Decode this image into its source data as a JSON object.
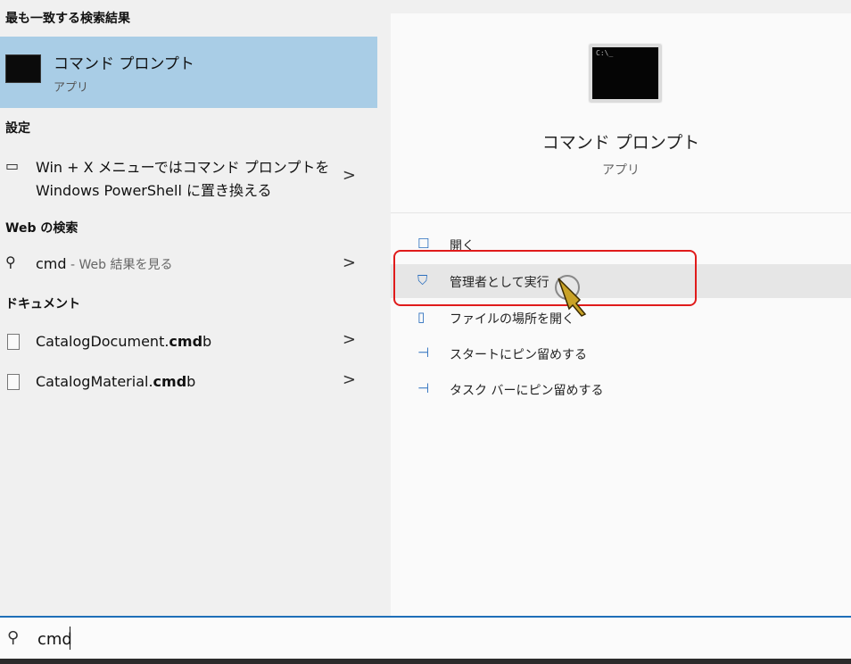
{
  "left": {
    "best_match_heading": "最も一致する検索結果",
    "best_match": {
      "title": "コマンド プロンプト",
      "subtitle": "アプリ"
    },
    "settings_heading": "設定",
    "settings_item": {
      "line1": "Win + X メニューではコマンド プロンプトを",
      "line2": "Windows PowerShell に置き換える"
    },
    "web_heading": "Web の検索",
    "web_item": {
      "query": "cmd",
      "suffix": " - Web 結果を見る"
    },
    "docs_heading": "ドキュメント",
    "docs": [
      {
        "prefix": "CatalogDocument.",
        "bold": "cmd",
        "suffix": "b"
      },
      {
        "prefix": "CatalogMaterial.",
        "bold": "cmd",
        "suffix": "b"
      }
    ],
    "chevron": ">"
  },
  "right": {
    "app_title": "コマンド プロンプト",
    "app_subtitle": "アプリ",
    "actions": [
      {
        "label": "開く",
        "icon": "open-icon"
      },
      {
        "label": "管理者として実行",
        "icon": "shield-admin-icon"
      },
      {
        "label": "ファイルの場所を開く",
        "icon": "folder-location-icon"
      },
      {
        "label": "スタートにピン留めする",
        "icon": "pin-icon"
      },
      {
        "label": "タスク バーにピン留めする",
        "icon": "pin-icon"
      }
    ]
  },
  "search": {
    "value": "cmd",
    "icon": "search-icon"
  },
  "colors": {
    "selected_bg": "#a9cde6",
    "accent": "#1e6fb8",
    "highlight_border": "#e01b1b"
  }
}
